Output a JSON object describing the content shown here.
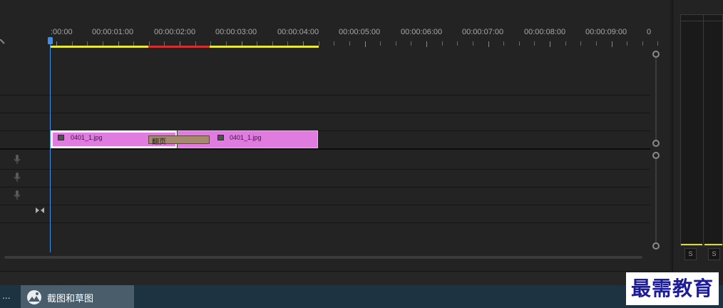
{
  "timeline": {
    "ruler_labels": [
      ":00:00",
      "00:00:01:00",
      "00:00:02:00",
      "00:00:03:00",
      "00:00:04:00",
      "00:00:05:00",
      "00:00:06:00",
      "00:00:07:00",
      "00:00:08:00",
      "00:00:09:00",
      "0"
    ],
    "playhead_color": "#3f8fe8",
    "render_bar_colors": {
      "yellow": "#e8e83a",
      "red": "#d42f2f"
    }
  },
  "clips": [
    {
      "name": "0401_1.jpg",
      "color": "#e07be0"
    },
    {
      "name": "0401_1.jpg",
      "color": "#e07be0"
    }
  ],
  "transition": {
    "label": "翻页",
    "color": "#a58a6e"
  },
  "audio_tracks": [
    {
      "icon": "microphone-icon"
    },
    {
      "icon": "microphone-icon"
    },
    {
      "icon": "microphone-icon"
    }
  ],
  "mixer": {
    "solo_labels": [
      "S",
      "S"
    ]
  },
  "taskbar": {
    "overflow": "...",
    "app_label": "截图和草图"
  },
  "watermark": {
    "text": "最需教育"
  }
}
